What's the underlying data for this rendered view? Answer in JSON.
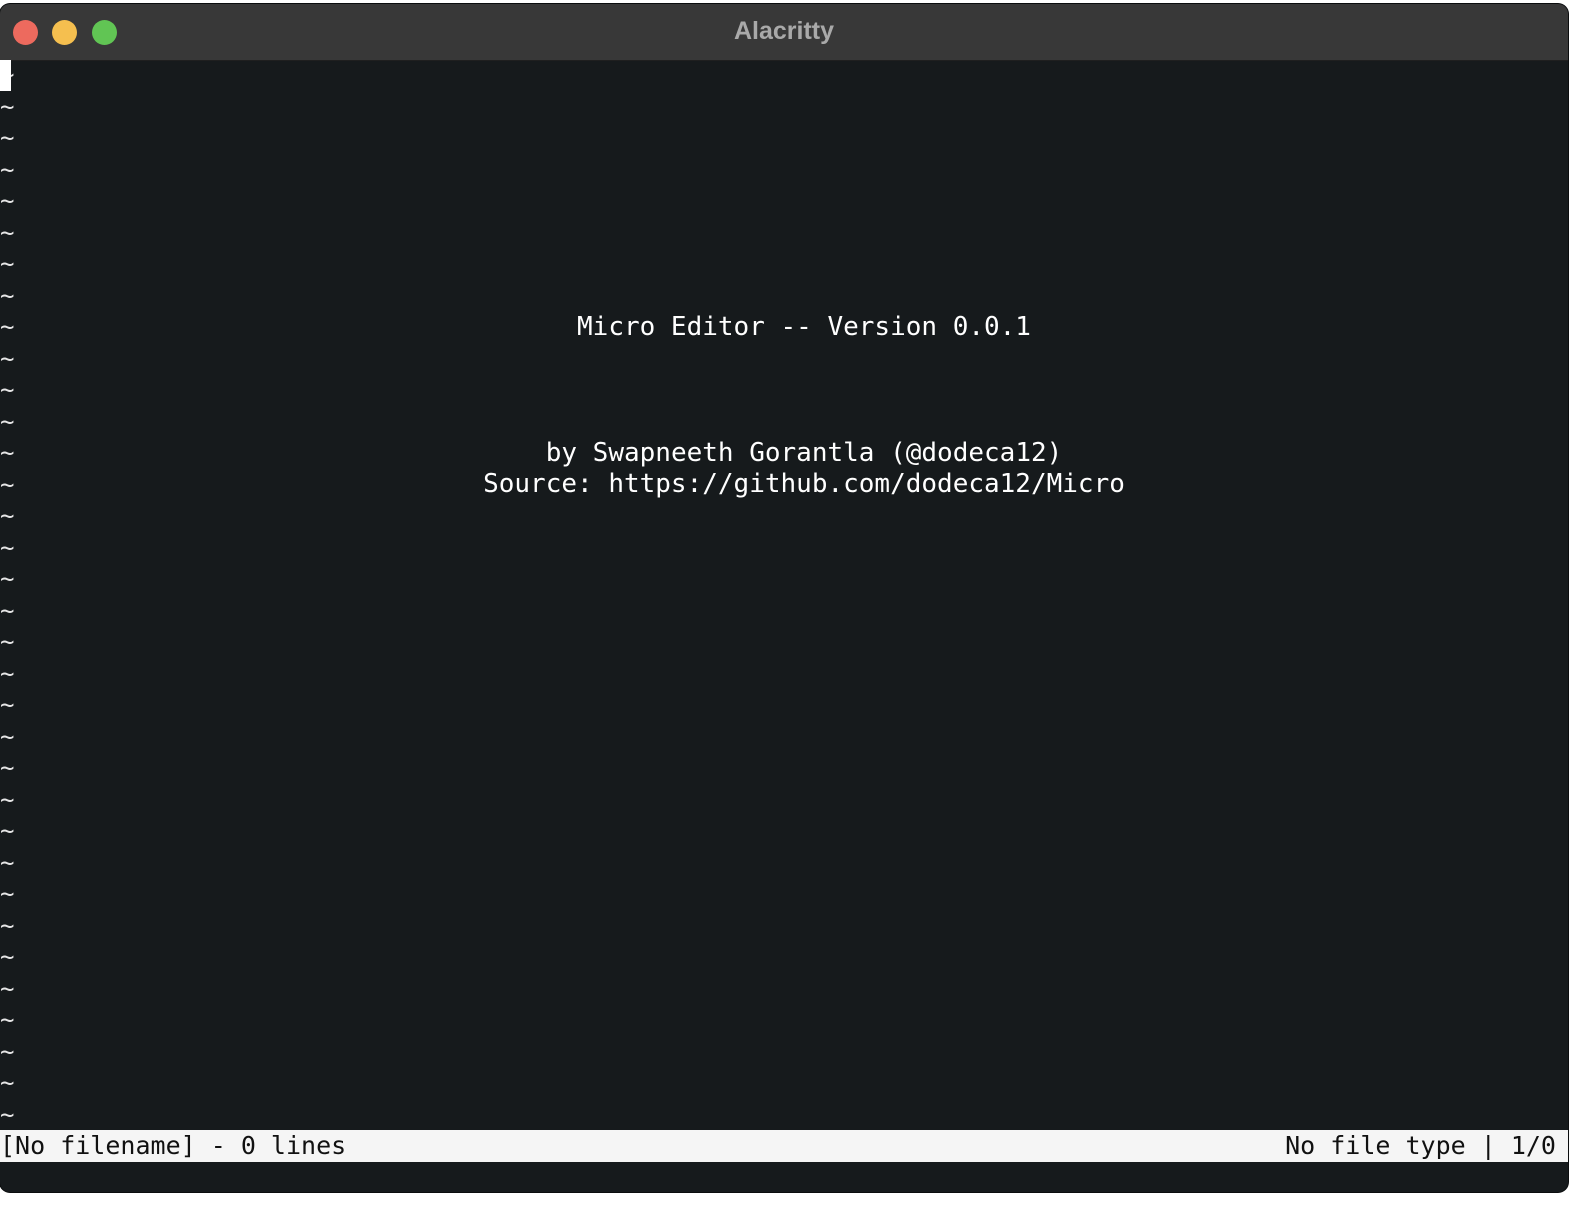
{
  "window": {
    "title": "Alacritty"
  },
  "editor": {
    "empty_line_marker": "~",
    "empty_line_count": 34,
    "welcome": {
      "line1": "Micro Editor -- Version 0.0.1",
      "line2": "by Swapneeth Gorantla (@dodeca12)",
      "line3": "Source: https://github.com/dodeca12/Micro"
    }
  },
  "statusbar": {
    "left": "[No filename] - 0 lines",
    "right": "No file type | 1/0"
  },
  "colors": {
    "terminal_bg": "#161a1c",
    "titlebar_bg": "#383838",
    "statusbar_bg": "#f5f5f5",
    "close": "#ed6a5e",
    "minimize": "#f5bf4f",
    "maximize": "#61c554"
  }
}
